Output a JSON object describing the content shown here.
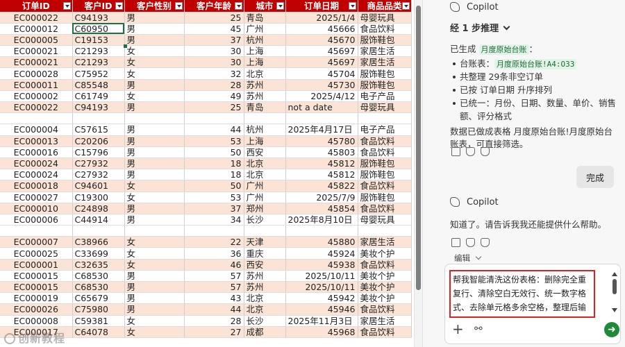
{
  "sheet": {
    "headers": [
      "订单ID",
      "客户ID",
      "客户性别",
      "客户年龄",
      "城市",
      "订单日期",
      "商品品类"
    ],
    "rows": [
      [
        "EC000022",
        "C94193",
        "男",
        "25",
        "青岛",
        "2025/1/4",
        "母婴玩具"
      ],
      [
        "EC000012",
        "C60950",
        "男",
        "45",
        "广州",
        "45666",
        "食品饮料"
      ],
      [
        "EC000005",
        "C19153",
        "男",
        "37",
        "杭州",
        "45670",
        "服饰鞋包"
      ],
      [
        "EC000021",
        "C21293",
        "女",
        "30",
        "上海",
        "45697",
        "家居生活"
      ],
      [
        "EC000021",
        "C21293",
        "女",
        "30",
        "上海",
        "45697",
        "家居生活"
      ],
      [
        "EC000028",
        "C75952",
        "女",
        "32",
        "北京",
        "45704",
        "服饰鞋包"
      ],
      [
        "EC000011",
        "C85548",
        "男",
        "28",
        "苏州",
        "45730",
        "服饰鞋包"
      ],
      [
        "EC000002",
        "C61749",
        "女",
        "49",
        "苏州",
        "2025/4/12",
        "电子产品"
      ],
      [
        "EC000022",
        "C94193",
        "男",
        "25",
        "青岛",
        "not a date",
        "母婴玩具"
      ],
      [
        "",
        "",
        "",
        "",
        "",
        "",
        ""
      ],
      [
        "EC000004",
        "C57615",
        "男",
        "44",
        "杭州",
        "2025年4月17日",
        "电子产品"
      ],
      [
        "EC000013",
        "C20206",
        "男",
        "53",
        "上海",
        "45780",
        "食品饮料"
      ],
      [
        "EC000016",
        "C15796",
        "男",
        "50",
        "西安",
        "45803",
        "食品饮料"
      ],
      [
        "EC000024",
        "C27932",
        "男",
        "18",
        "北京",
        "45812",
        "服饰鞋包"
      ],
      [
        "EC000024",
        "C27932",
        "男",
        "18",
        "北京",
        "45812",
        "服饰鞋包"
      ],
      [
        "EC000018",
        "C94601",
        "女",
        "50",
        "广州",
        "45822",
        "食品饮料"
      ],
      [
        "EC000027",
        "C19300",
        "女",
        "53",
        "广州",
        "2025/7/9",
        "服饰鞋包"
      ],
      [
        "EC000010",
        "C24898",
        "男",
        "37",
        "郑州",
        "45854",
        "食品饮料"
      ],
      [
        "EC000006",
        "C44914",
        "男",
        "34",
        "长沙",
        "2025年8月10日",
        "母婴玩具"
      ],
      [
        "",
        "",
        "",
        "",
        "",
        "",
        ""
      ],
      [
        "EC000007",
        "C38966",
        "女",
        "22",
        "天津",
        "45880",
        "家居生活"
      ],
      [
        "EC000025",
        "C33699",
        "女",
        "36",
        "重庆",
        "45924",
        "美妆个护"
      ],
      [
        "EC000001",
        "C32635",
        "女",
        "46",
        "西安",
        "45938",
        "食品饮料"
      ],
      [
        "EC000015",
        "C68530",
        "男",
        "57",
        "苏州",
        "2025/10/11",
        "美妆个护"
      ],
      [
        "EC000015",
        "C68530",
        "男",
        "57",
        "苏州",
        "2025/10/11",
        "美妆个护"
      ],
      [
        "EC000019",
        "C65679",
        "男",
        "43",
        "北京",
        "45942",
        "美妆个护"
      ],
      [
        "EC000026",
        "C75980",
        "男",
        "44",
        "北京",
        "45946",
        "食品饮料"
      ],
      [
        "EC000008",
        "C59381",
        "女",
        "28",
        "长沙",
        "2025年11月3日",
        "家居生活"
      ],
      [
        "EC000017",
        "C64078",
        "女",
        "27",
        "成都",
        "45968",
        "食品饮料"
      ]
    ]
  },
  "watermark": "创新教程",
  "copilot": {
    "name": "Copilot",
    "steps_label": "经 1 步推理",
    "msg1_prefix": "已生成",
    "msg1_tag": "月度原始台账",
    "msg1_suffix": "：",
    "bullet1_prefix": "台账表：",
    "bullet1_tag": "月度原始台账!A4:O33",
    "bullet2": "共整理 29条非空订单",
    "bullet3": "已按 订单日期 升序排列",
    "bullet4": "已统一：月份、日期、数量、单价、销售额、评分格式",
    "msg1_footer": "数据已做成表格 月度原始台账!月度原始台账表，可直接筛选。",
    "done_button": "完成",
    "name2": "Copilot",
    "msg2": "知道了。请告诉我我还能提供什么帮助。",
    "edit_label": "编辑",
    "prompt_text": "帮我智能清洗这份表格：删除完全重复行、清除空白无效行、统一数字格式、去除单元格多余空格，整理后输出干净数据表，并告诉我本次一共清理了多少条无效",
    "plus_label": "+",
    "link_label": "⚯",
    "send_label": "➜"
  }
}
